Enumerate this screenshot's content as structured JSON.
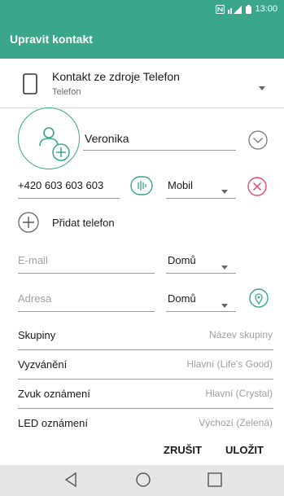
{
  "status_bar": {
    "time": "13:00"
  },
  "app_bar": {
    "title": "Upravit kontakt"
  },
  "source": {
    "title": "Kontakt ze zdroje Telefon",
    "subtitle": "Telefon"
  },
  "contact": {
    "name": "Veronika"
  },
  "phone": {
    "number": "+420 603 603 603",
    "type": "Mobil"
  },
  "add_phone": {
    "label": "Přidat telefon"
  },
  "email": {
    "placeholder": "E-mail",
    "type": "Domů"
  },
  "address": {
    "placeholder": "Adresa",
    "type": "Domů"
  },
  "fields": [
    {
      "label": "Skupiny",
      "value": "Název skupiny"
    },
    {
      "label": "Vyzvánění",
      "value": "Hlavní (Life's Good)"
    },
    {
      "label": "Zvuk oznámení",
      "value": "Hlavní (Crystal)"
    },
    {
      "label": "LED oznámení",
      "value": "Výchozí (Zelená)"
    }
  ],
  "actions": {
    "cancel": "ZRUŠIT",
    "save": "ULOŽIT"
  },
  "colors": {
    "accent": "#3aa68a",
    "remove": "#e8456b"
  }
}
